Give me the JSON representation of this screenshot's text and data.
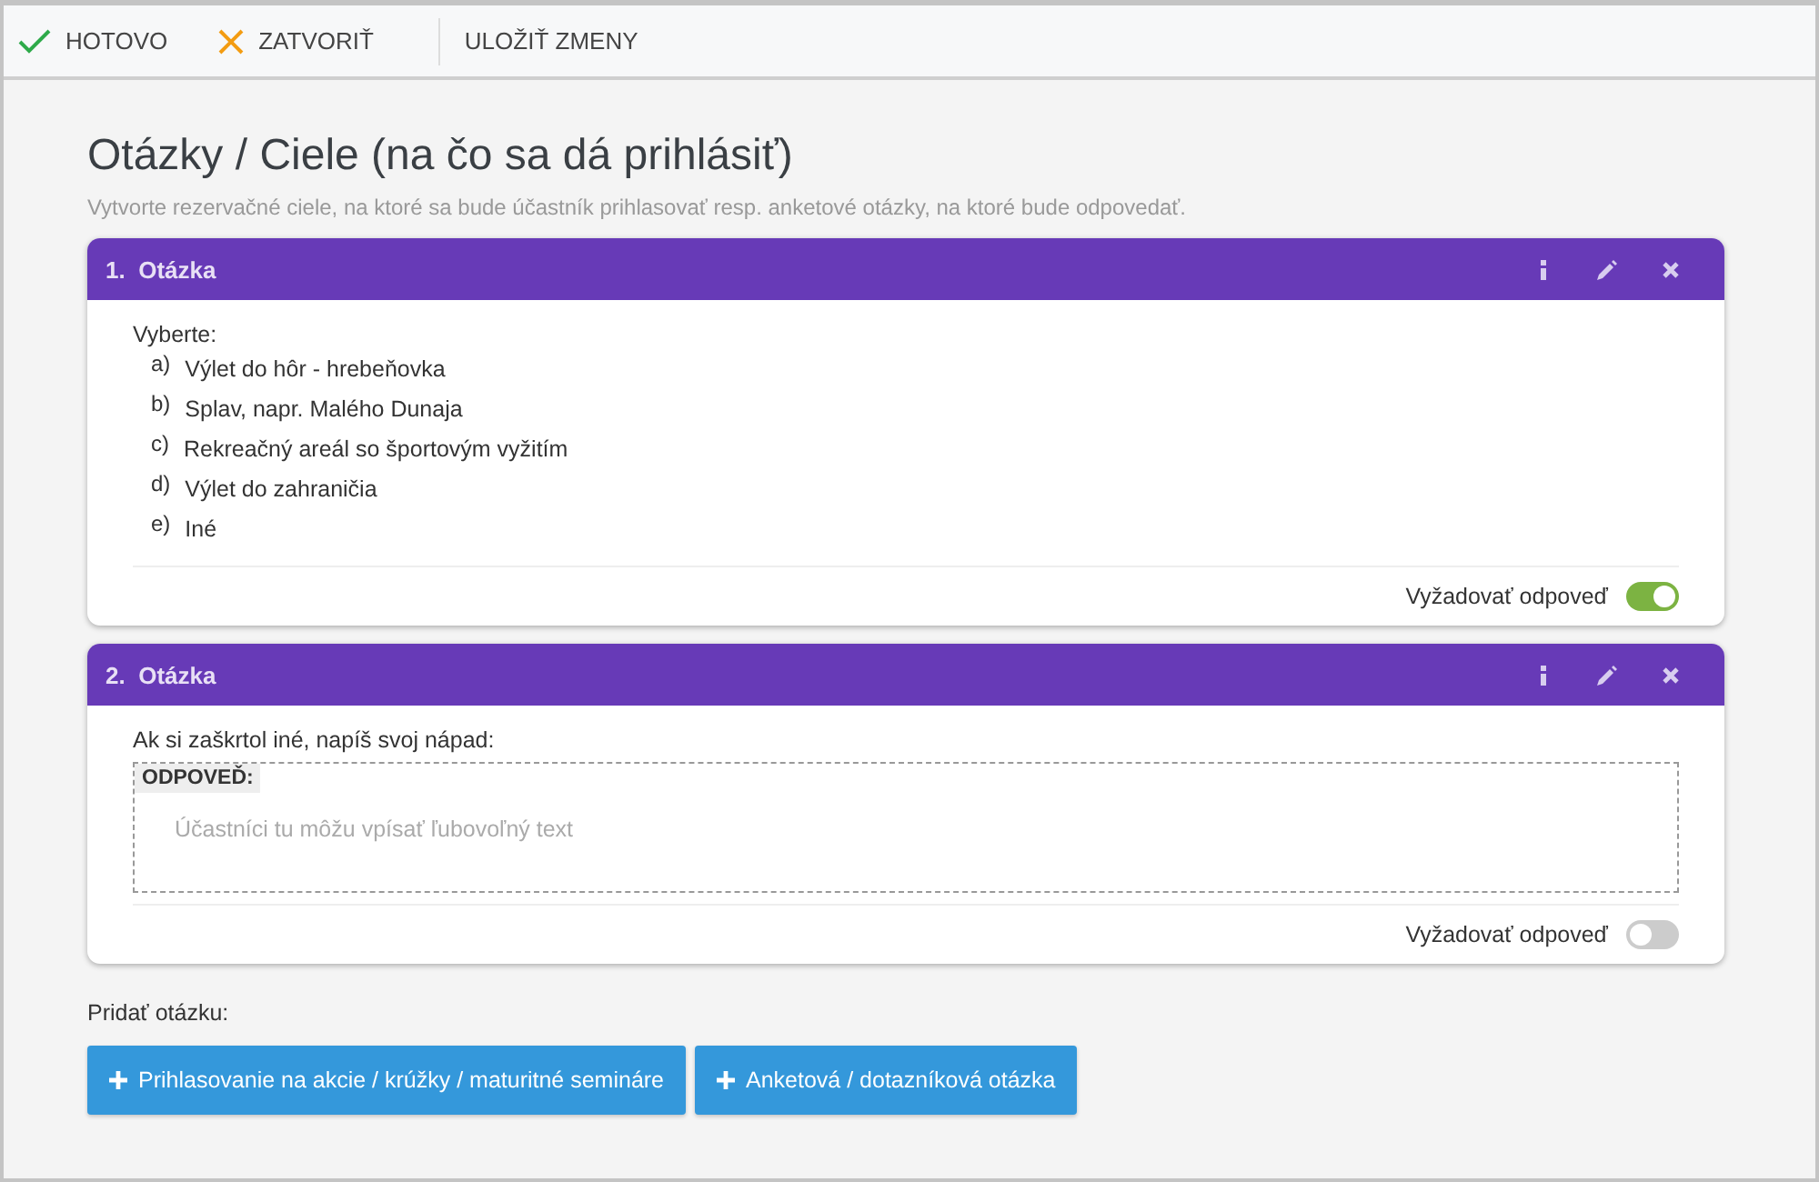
{
  "toolbar": [
    {
      "kind": "done",
      "label": "HOTOVO"
    },
    {
      "kind": "close",
      "label": "ZATVORIŤ"
    },
    {
      "kind": "save",
      "label": "ULOŽIŤ ZMENY"
    }
  ],
  "heading": {
    "title": "Otázky / Ciele (na čo sa dá prihlásiť)",
    "subtitle": "Vytvorte rezervačné ciele, na ktoré sa bude účastník prihlasovať resp. anketové otázky, na ktoré bude odpovedať."
  },
  "questions": [
    {
      "kind": "choice",
      "number": "1.",
      "title": "Otázka",
      "prompt": "Vyberte:",
      "options": [
        {
          "letter": "a)",
          "text": "Výlet do hôr - hrebeňovka"
        },
        {
          "letter": "b)",
          "text": "Splav, napr. Malého Dunaja"
        },
        {
          "letter": "c)",
          "text": "Rekreačný areál so športovým vyžitím"
        },
        {
          "letter": "d)",
          "text": "Výlet do zahraničia"
        },
        {
          "letter": "e)",
          "text": "Iné"
        }
      ],
      "require_label": "Vyžadovať odpoveď",
      "required": true
    },
    {
      "kind": "text",
      "number": "2.",
      "title": "Otázka",
      "prompt": "Ak si zaškrtol iné, napíš svoj nápad:",
      "answer_label": "ODPOVEĎ:",
      "placeholder": "Účastníci tu môžu vpísať ľubovoľný text",
      "require_label": "Vyžadovať odpoveď",
      "required": false
    }
  ],
  "add": {
    "label": "Pridať otázku:",
    "buttons": [
      "Prihlasovanie na akcie / krúžky / maturitné semináre",
      "Anketová / dotazníková otázka"
    ]
  }
}
